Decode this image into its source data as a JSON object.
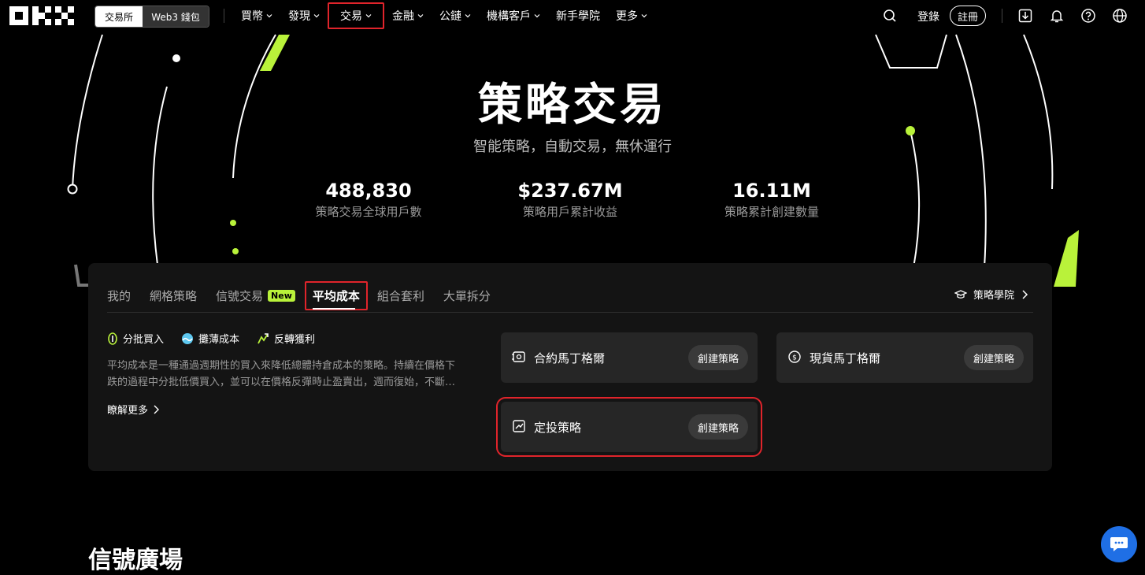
{
  "nav": {
    "segment": {
      "exchange": "交易所",
      "wallet": "Web3 錢包"
    },
    "menu": [
      "買幣",
      "發現",
      "交易",
      "金融",
      "公鏈",
      "機構客戶",
      "新手學院",
      "更多"
    ],
    "login": "登錄",
    "register": "註冊"
  },
  "hero": {
    "title": "策略交易",
    "subtitle": "智能策略，自動交易，無休運行",
    "stats": [
      {
        "value": "488,830",
        "label": "策略交易全球用戶數"
      },
      {
        "value": "$237.67M",
        "label": "策略用戶累計收益"
      },
      {
        "value": "16.11M",
        "label": "策略累計創建數量"
      }
    ]
  },
  "strategy": {
    "tabs": [
      "我的",
      "網格策略",
      "信號交易",
      "平均成本",
      "組合套利",
      "大單拆分"
    ],
    "new_badge": "New",
    "academy": "策略學院",
    "features": [
      "分批買入",
      "攤薄成本",
      "反轉獲利"
    ],
    "description_line1": "平均成本是一種通過週期性的買入來降低總體持倉成本的策略。持續在價格下",
    "description_line2": "跌的過程中分批低價買入，並可以在價格反彈時止盈賣出，週而復始，不斷…",
    "learn_more": "瞭解更多",
    "cards": [
      {
        "name": "合約馬丁格爾",
        "button": "創建策略"
      },
      {
        "name": "現貨馬丁格爾",
        "button": "創建策略"
      },
      {
        "name": "定投策略",
        "button": "創建策略"
      }
    ]
  },
  "section_title": "信號廣場",
  "colors": {
    "accent_lime": "#b9f23a",
    "highlight_red": "#e0242b",
    "chat_blue": "#1f6fe5"
  }
}
